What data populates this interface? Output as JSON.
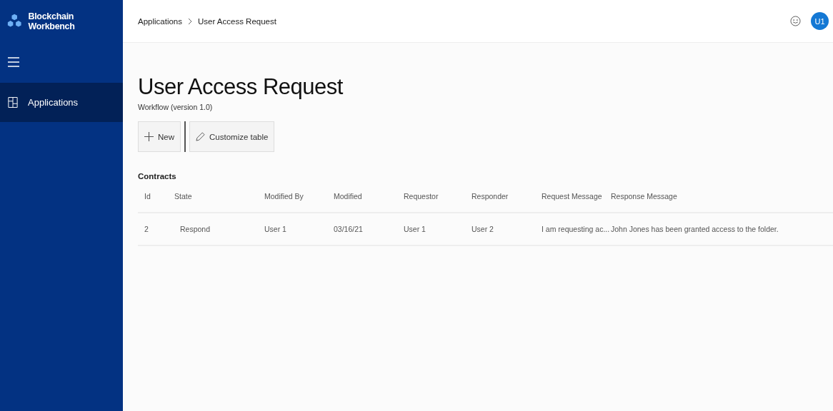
{
  "app": {
    "title": "Blockchain Workbench"
  },
  "sidebar": {
    "items": [
      {
        "label": "Applications",
        "selected": true
      }
    ]
  },
  "breadcrumb": [
    "Applications",
    "User Access Request"
  ],
  "user": {
    "initials": "U1"
  },
  "page": {
    "title": "User Access Request",
    "subtitle": "Workflow (version 1.0)"
  },
  "toolbar": [
    {
      "label": "New",
      "kind": "new"
    },
    {
      "label": "Customize table",
      "kind": "customize"
    }
  ],
  "table": {
    "title": "Contracts",
    "columns": [
      "Id",
      "State",
      "Modified By",
      "Modified",
      "Requestor",
      "Responder",
      "Request Message",
      "Response Message"
    ],
    "rows": [
      [
        "2",
        "Respond",
        "User 1",
        "03/16/21",
        "User 1",
        "User 2",
        "I am requesting ac...",
        "John Jones has been granted access to the folder."
      ]
    ]
  }
}
